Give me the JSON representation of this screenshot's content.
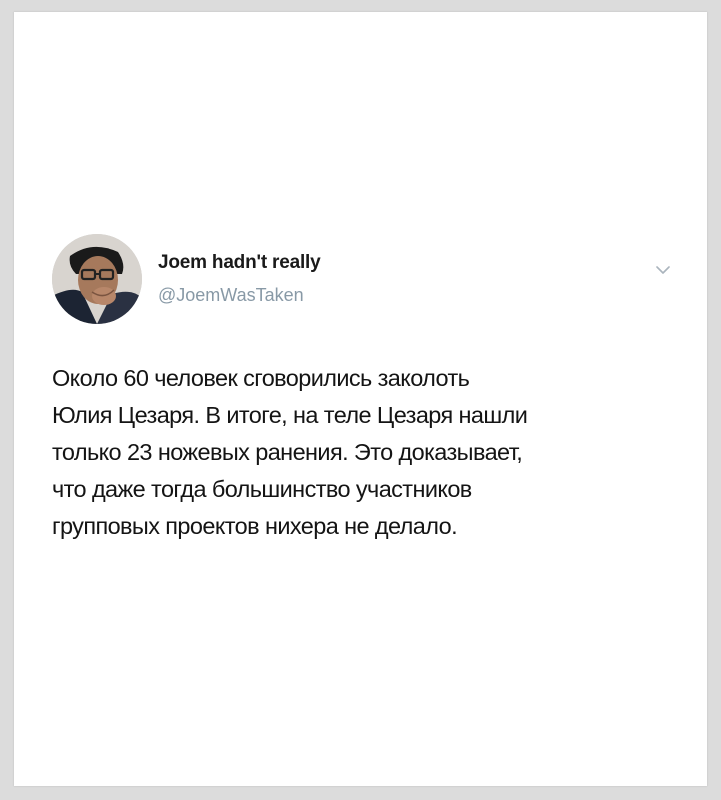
{
  "author": {
    "display_name": "Joem hadn't really",
    "handle": "@JoemWasTaken"
  },
  "menu_icon": "chevron-down-icon",
  "tweet": {
    "lines": [
      "Около 60 человек сговорились заколоть",
      "Юлия Цезаря. В итоге, на теле Цезаря нашли",
      "только 23 ножевых ранения. Это доказывает,",
      "что даже тогда большинство участников",
      "групповых проектов нихера не делало."
    ]
  },
  "colors": {
    "background": "#ffffff",
    "page_border": "#dcdcdc",
    "name": "#1a1a1a",
    "handle": "#8899a6",
    "text": "#141414"
  }
}
